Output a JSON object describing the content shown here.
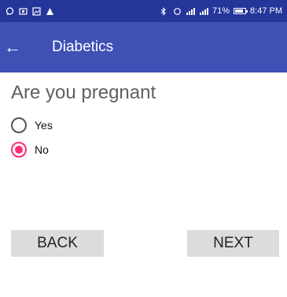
{
  "status_bar": {
    "battery_percent": "71%",
    "time": "8:47 PM",
    "icons_left": [
      "chat-icon",
      "camera-icon",
      "gallery-icon",
      "warning-icon"
    ],
    "icons_right": [
      "bluetooth-icon",
      "sync-icon",
      "signal-icon",
      "signal-icon",
      "battery-icon"
    ]
  },
  "app_bar": {
    "back_icon": "←",
    "title": "Diabetics"
  },
  "question": {
    "text": "Are you pregnant",
    "options": [
      {
        "label": "Yes",
        "checked": false
      },
      {
        "label": "No",
        "checked": true
      }
    ]
  },
  "buttons": {
    "back_label": "BACK",
    "next_label": "NEXT"
  },
  "colors": {
    "status_bar": "#25359a",
    "app_bar": "#3f51b5",
    "accent": "#ff2f73",
    "button": "#dcdcdc"
  }
}
